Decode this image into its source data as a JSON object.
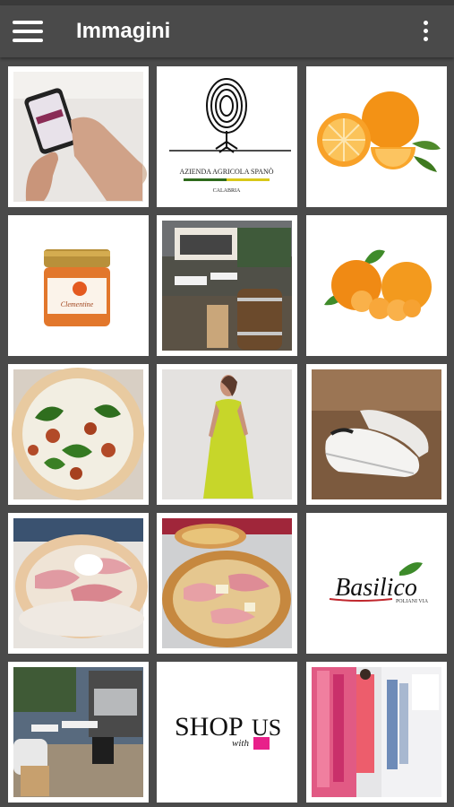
{
  "app": {
    "title": "Immagini"
  },
  "tiles": [
    {
      "name": "phone-hand-photo"
    },
    {
      "name": "azienda-agricola-spano-logo",
      "line1": "AZIENDA AGRICOLA SPANÒ",
      "line2": "CALABRIA"
    },
    {
      "name": "oranges-photo"
    },
    {
      "name": "jam-jar-photo",
      "jar_label": "Clementine"
    },
    {
      "name": "outdoor-terrace-photo"
    },
    {
      "name": "mandarins-photo"
    },
    {
      "name": "spinach-pizza-photo"
    },
    {
      "name": "green-dress-photo"
    },
    {
      "name": "white-shoes-photo"
    },
    {
      "name": "prosciutto-pizza-photo"
    },
    {
      "name": "pizza-box-photo"
    },
    {
      "name": "basilico-logo",
      "brand": "Basilico",
      "tagline": "POLIANI VIA"
    },
    {
      "name": "terrace-night-photo"
    },
    {
      "name": "shop-with-us-logo",
      "word1": "SHOP",
      "word2": "with",
      "word3": "US"
    },
    {
      "name": "boutique-photo"
    }
  ]
}
